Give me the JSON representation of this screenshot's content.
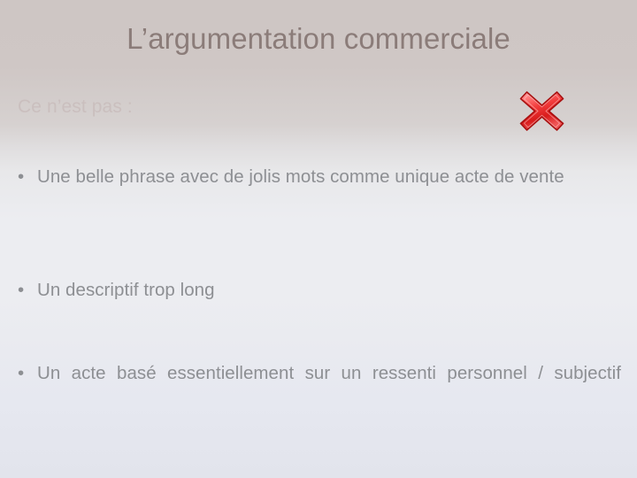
{
  "slide": {
    "title": "L’argumentation commerciale",
    "intro": "Ce n’est pas :",
    "bullet_marker": "•",
    "icon": {
      "name": "red-cross-x-icon",
      "color_outline": "#b01515",
      "color_fill_light": "#ff8a8a",
      "color_fill_dark": "#d81c1c"
    },
    "colors": {
      "title_text": "#8b7c79",
      "intro_text": "#cabfbe",
      "body_text": "#8d8f93",
      "bg_top": "#cec6c4",
      "bg_mid": "#ecedf1",
      "bg_bottom": "#e2e4ec"
    },
    "bullets": [
      "Une belle phrase avec de jolis mots comme unique acte de vente",
      "Un descriptif trop long",
      "Un acte basé essentiellement sur un ressenti personnel / subjectif"
    ]
  }
}
